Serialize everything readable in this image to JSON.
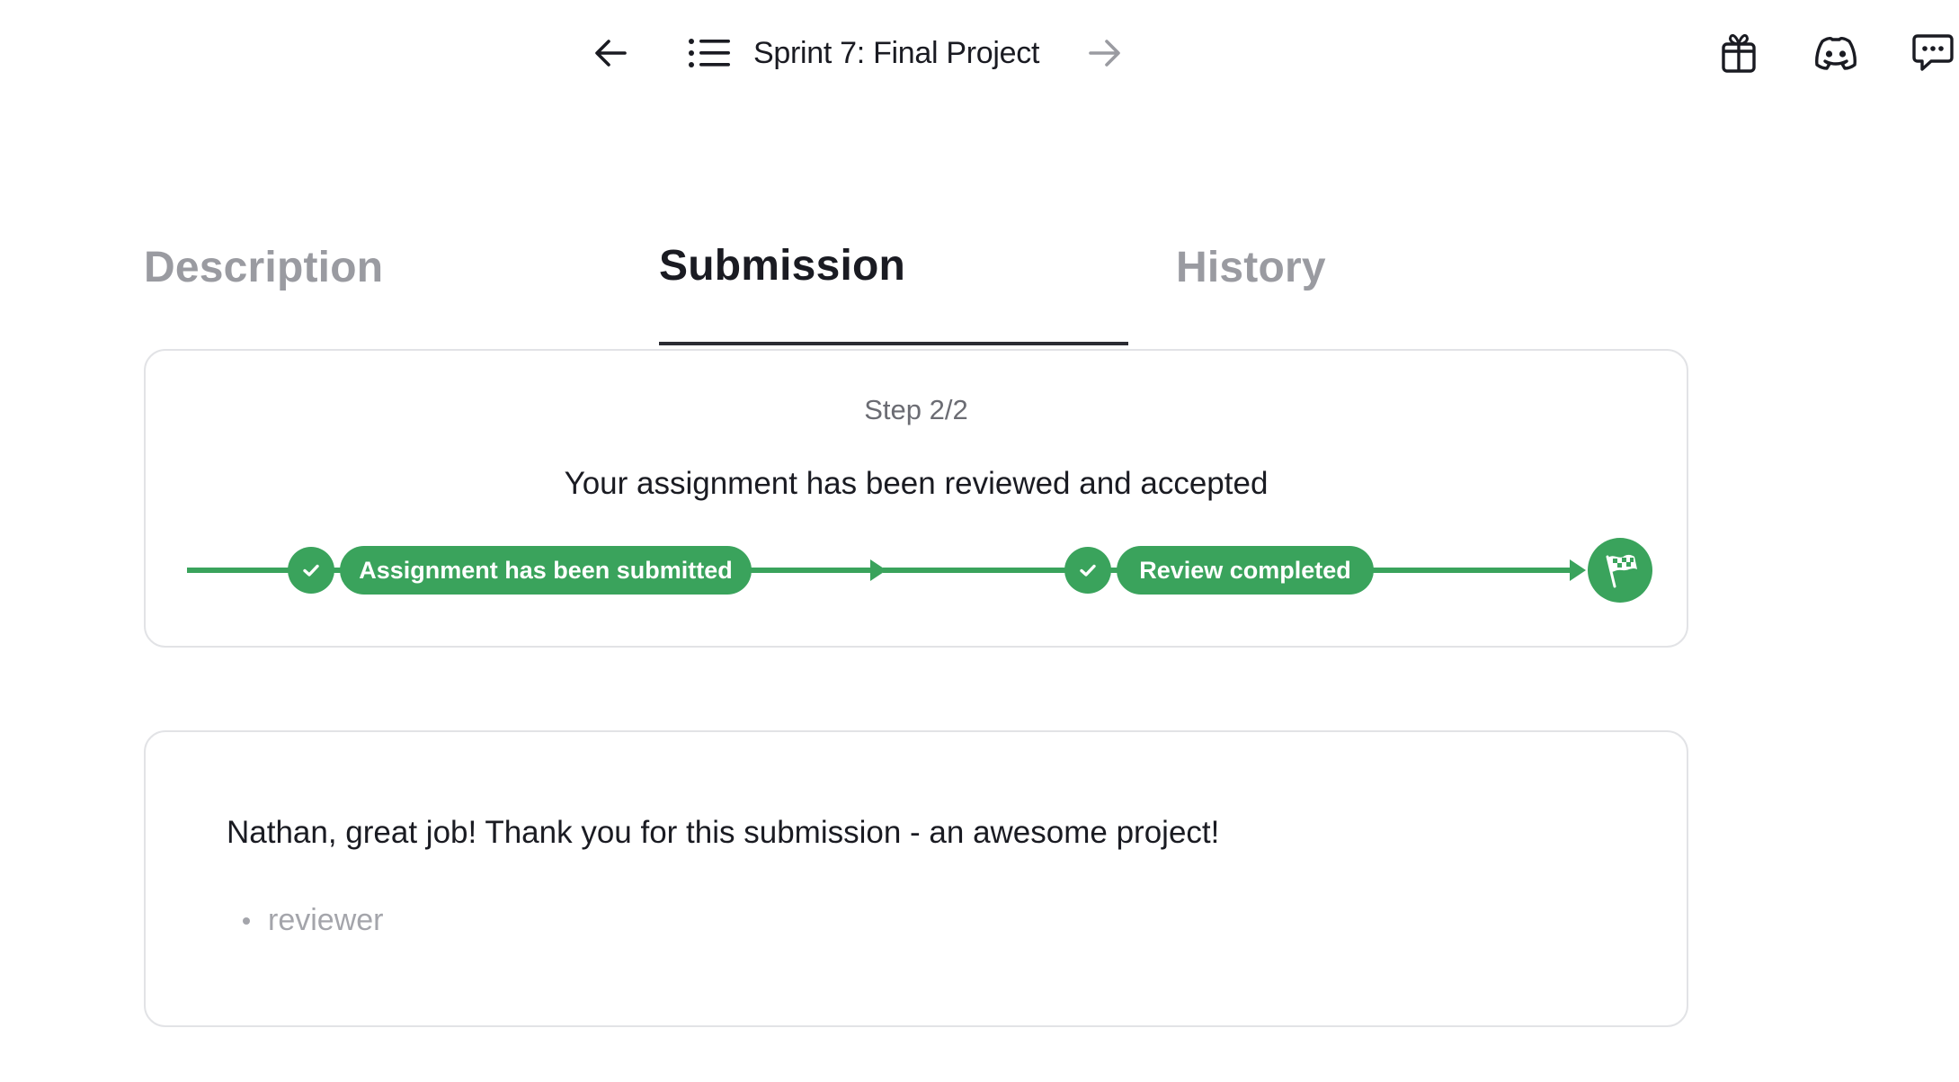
{
  "nav": {
    "title": "Sprint 7: Final Project",
    "back_icon": "arrow-left-icon",
    "forward_icon": "arrow-right-icon",
    "list_icon": "list-icon",
    "right_icons": [
      "gift-icon",
      "discord-icon",
      "chat-icon"
    ]
  },
  "tabs": [
    {
      "label": "Description",
      "active": false
    },
    {
      "label": "Submission",
      "active": true
    },
    {
      "label": "History",
      "active": false
    }
  ],
  "status": {
    "step": "Step 2/2",
    "message": "Your assignment has been reviewed and accepted",
    "steps": [
      {
        "label": "Assignment has been submitted",
        "done": true
      },
      {
        "label": "Review completed",
        "done": true
      }
    ],
    "finish_icon": "checkered-flag-icon"
  },
  "review": {
    "comment": "Nathan, great job! Thank you for this submission - an awesome project!",
    "author_role": "reviewer"
  },
  "colors": {
    "accent_green": "#3aa35c",
    "text_primary": "#1a1b22",
    "text_muted": "#9a9ba1",
    "border": "#e2e3e6"
  }
}
